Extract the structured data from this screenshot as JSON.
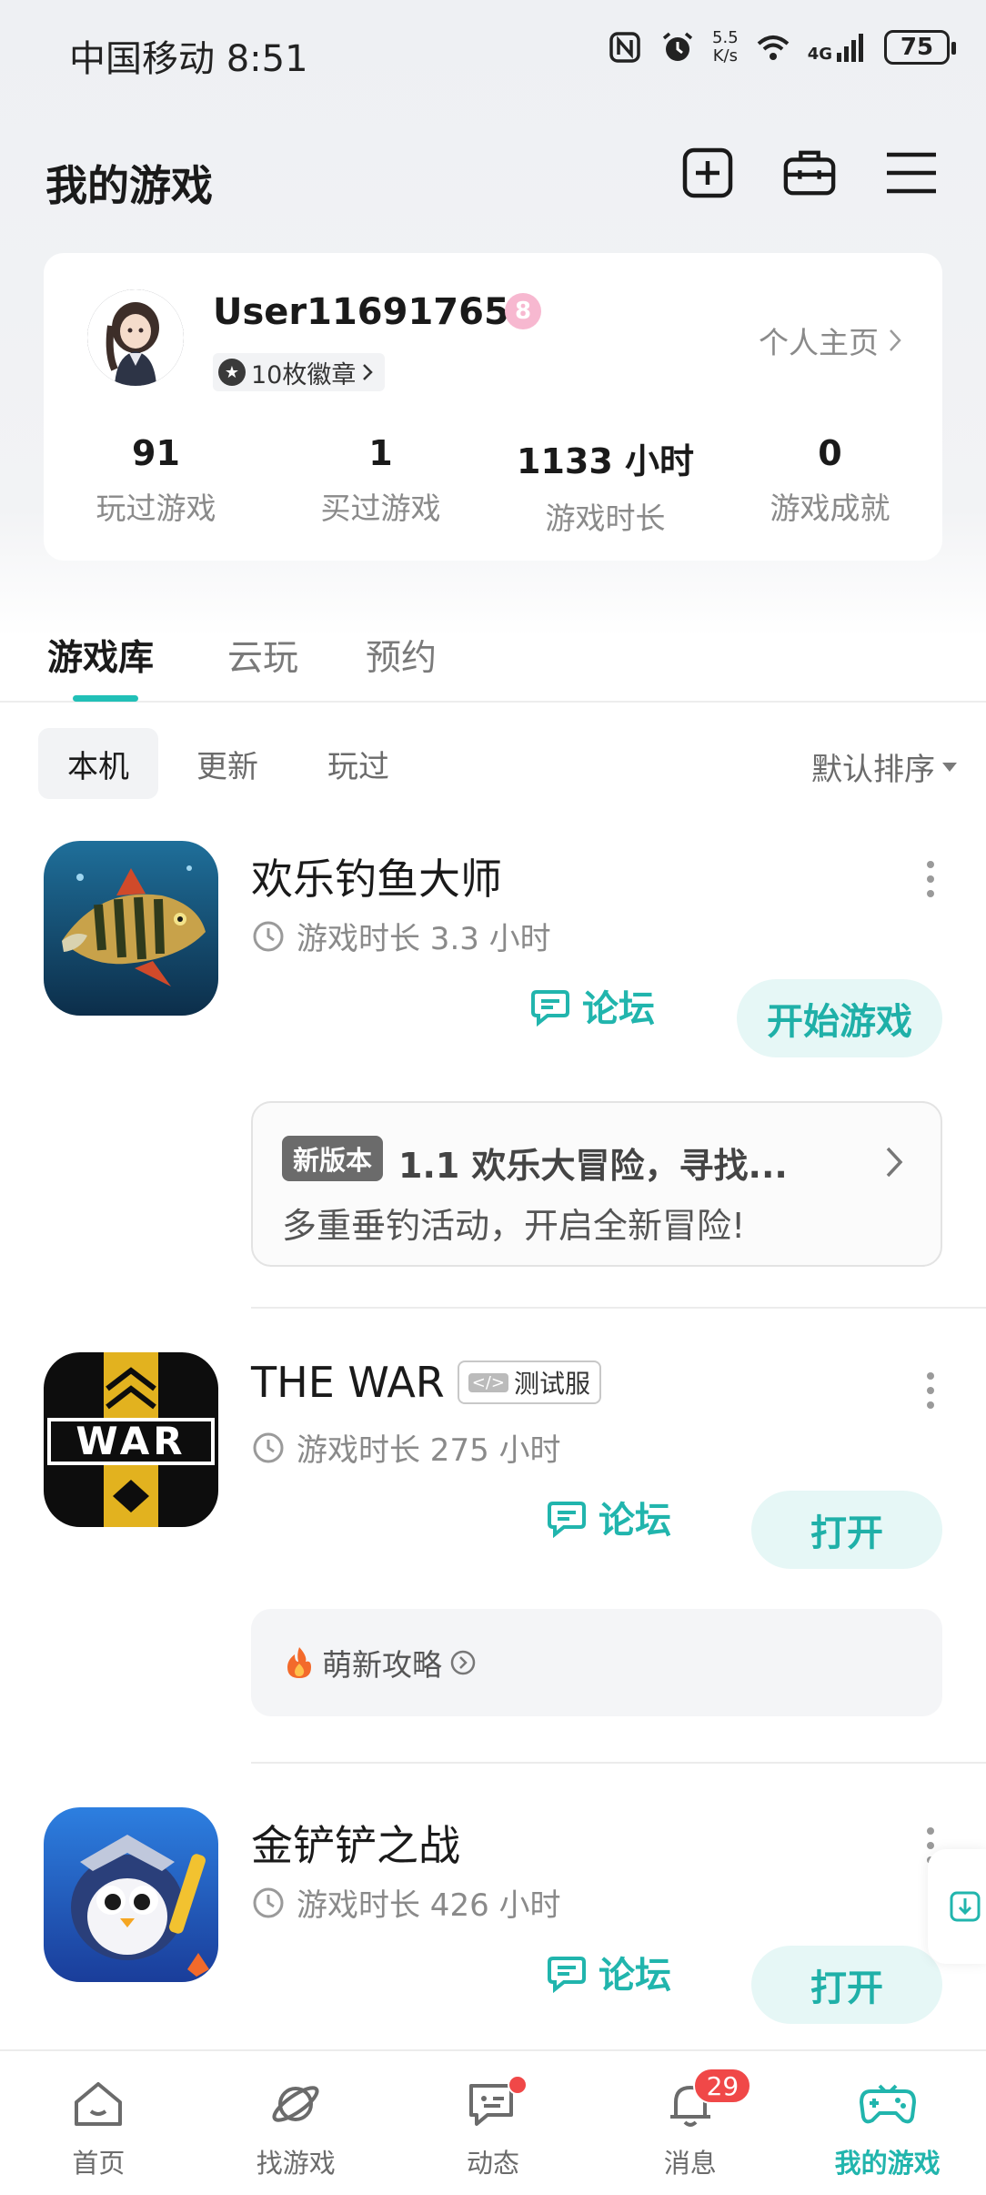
{
  "status_bar": {
    "carrier_time": "中国移动 8:51",
    "net_speed_value": "5.5",
    "net_speed_unit": "K/s",
    "network": "4G",
    "battery": "75",
    "icons": [
      "nfc-icon",
      "alarm-icon",
      "wifi-icon",
      "signal-icon"
    ]
  },
  "header": {
    "title": "我的游戏",
    "actions": [
      "add-game-icon",
      "toolbox-icon",
      "menu-icon"
    ]
  },
  "user": {
    "name": "User116917650",
    "level": "8",
    "medals": "10枚徽章",
    "profile_link": "个人主页",
    "stats": [
      {
        "value": "91",
        "label": "玩过游戏"
      },
      {
        "value": "1",
        "label": "买过游戏"
      },
      {
        "value": "1133 小时",
        "label": "游戏时长"
      },
      {
        "value": "0",
        "label": "游戏成就"
      }
    ]
  },
  "tabs": [
    "游戏库",
    "云玩",
    "预约"
  ],
  "filters": [
    "本机",
    "更新",
    "玩过"
  ],
  "sort_label": "默认排序",
  "games": [
    {
      "name": "欢乐钓鱼大师",
      "playtime": "游戏时长 3.3 小时",
      "forum": "论坛",
      "action": "开始游戏",
      "update_tag": "新版本",
      "update_title": "1.1 欢乐大冒险，寻找...",
      "update_desc": "多重垂钓活动，开启全新冒险!"
    },
    {
      "name": "THE WAR",
      "tag": "测试服",
      "playtime": "游戏时长 275 小时",
      "forum": "论坛",
      "action": "打开",
      "guide": "萌新攻略"
    },
    {
      "name": "金铲铲之战",
      "playtime": "游戏时长 426 小时",
      "forum": "论坛",
      "action": "打开"
    }
  ],
  "bottom_nav": [
    {
      "label": "首页",
      "icon": "home-icon"
    },
    {
      "label": "找游戏",
      "icon": "planet-icon"
    },
    {
      "label": "动态",
      "icon": "feed-icon"
    },
    {
      "label": "消息",
      "icon": "bell-icon",
      "badge": "29"
    },
    {
      "label": "我的游戏",
      "icon": "gamepad-icon",
      "active": true
    }
  ],
  "colors": {
    "accent": "#21b5ad",
    "badge_red": "#f04848",
    "text_gray": "#8a8a8a"
  }
}
